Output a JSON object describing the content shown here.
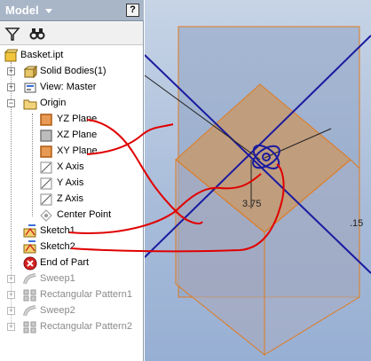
{
  "panel": {
    "title": "Model",
    "help_label": "?"
  },
  "toolbar": {
    "filter_icon": "filter-icon",
    "find_icon": "binoculars-icon"
  },
  "tree": {
    "root": "Basket.ipt",
    "items": [
      {
        "label": "Solid Bodies(1)",
        "icon": "solid-bodies-icon",
        "dim": false
      },
      {
        "label": "View: Master",
        "icon": "view-icon",
        "dim": false
      },
      {
        "label": "Origin",
        "icon": "folder-icon",
        "dim": false
      },
      {
        "label": "YZ Plane",
        "icon": "plane-icon",
        "dim": false
      },
      {
        "label": "XZ Plane",
        "icon": "plane-icon",
        "dim": false
      },
      {
        "label": "XY Plane",
        "icon": "plane-icon",
        "dim": false
      },
      {
        "label": "X Axis",
        "icon": "axis-icon",
        "dim": false
      },
      {
        "label": "Y Axis",
        "icon": "axis-icon",
        "dim": false
      },
      {
        "label": "Z Axis",
        "icon": "axis-icon",
        "dim": false
      },
      {
        "label": "Center Point",
        "icon": "point-icon",
        "dim": false
      },
      {
        "label": "Sketch1",
        "icon": "sketch-icon",
        "dim": false
      },
      {
        "label": "Sketch2",
        "icon": "sketch-icon",
        "dim": false
      },
      {
        "label": "End of Part",
        "icon": "end-of-part-icon",
        "dim": false
      },
      {
        "label": "Sweep1",
        "icon": "sweep-icon",
        "dim": true
      },
      {
        "label": "Rectangular Pattern1",
        "icon": "pattern-icon",
        "dim": true
      },
      {
        "label": "Sweep2",
        "icon": "sweep-icon",
        "dim": true
      },
      {
        "label": "Rectangular Pattern2",
        "icon": "pattern-icon",
        "dim": true
      }
    ]
  },
  "viewport": {
    "dimension_value": "3.75",
    "dimension_value_2": ".15"
  },
  "colors": {
    "panel_header": "#a9b6c8",
    "plane_fill": "#c59a6e",
    "plane_edge": "#e07a1e",
    "axis": "#1a1aa0",
    "annotation": "#e00000"
  }
}
